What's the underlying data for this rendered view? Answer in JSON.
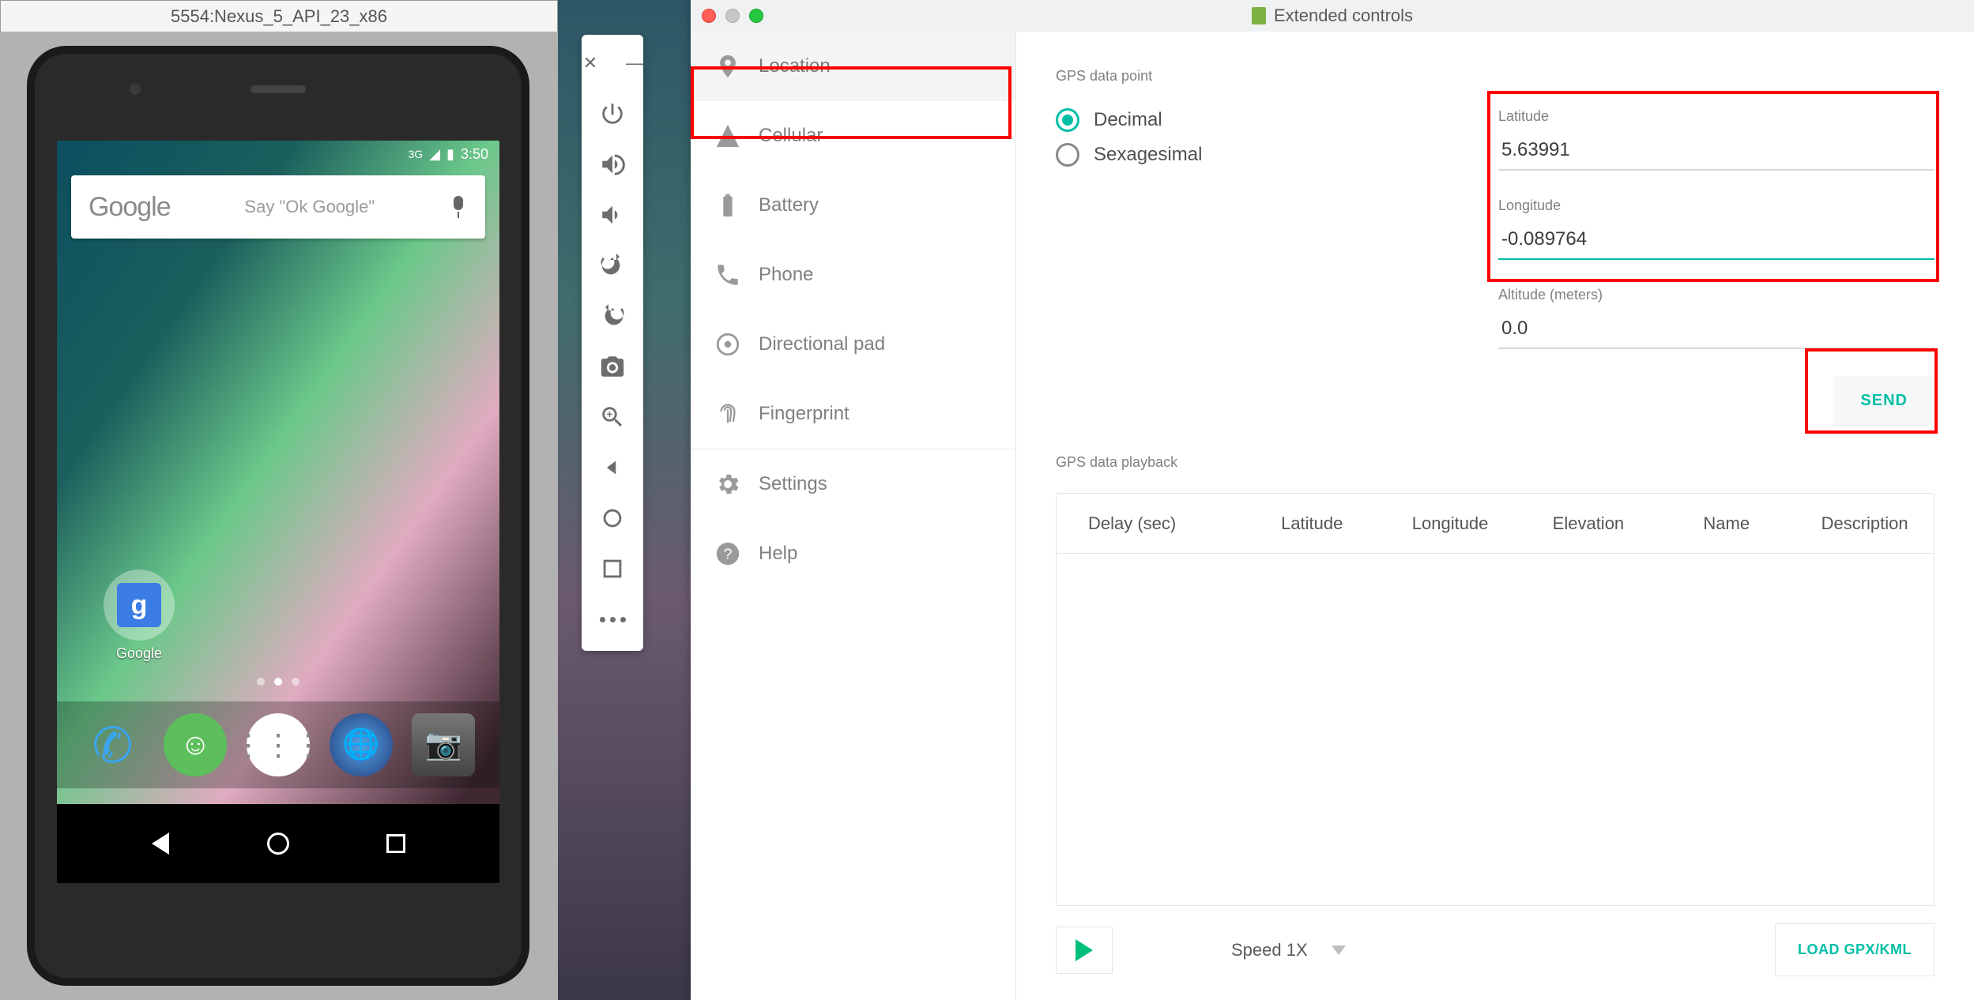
{
  "emulator": {
    "window_title": "5554:Nexus_5_API_23_x86",
    "status_time": "3:50",
    "status_net": "3G",
    "search_logo": "Google",
    "search_hint": "Say \"Ok Google\"",
    "google_app_label": "Google",
    "google_g": "g"
  },
  "extended": {
    "window_title": "Extended controls",
    "sidebar": {
      "items": [
        {
          "id": "location",
          "label": "Location"
        },
        {
          "id": "cellular",
          "label": "Cellular"
        },
        {
          "id": "battery",
          "label": "Battery"
        },
        {
          "id": "phone",
          "label": "Phone"
        },
        {
          "id": "dpad",
          "label": "Directional pad"
        },
        {
          "id": "fingerprint",
          "label": "Fingerprint"
        },
        {
          "id": "settings",
          "label": "Settings"
        },
        {
          "id": "help",
          "label": "Help"
        }
      ]
    },
    "gps_point": {
      "section_label": "GPS data point",
      "radio_decimal": "Decimal",
      "radio_sexagesimal": "Sexagesimal",
      "lat_label": "Latitude",
      "lat_value": "5.63991",
      "lon_label": "Longitude",
      "lon_value": "-0.089764",
      "alt_label": "Altitude (meters)",
      "alt_value": "0.0",
      "send_label": "SEND"
    },
    "playback": {
      "section_label": "GPS data playback",
      "columns": [
        "Delay (sec)",
        "Latitude",
        "Longitude",
        "Elevation",
        "Name",
        "Description"
      ],
      "speed_label": "Speed 1X",
      "load_label": "LOAD GPX/KML"
    }
  }
}
